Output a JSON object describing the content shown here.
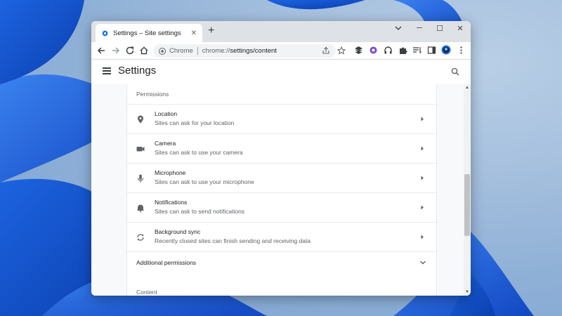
{
  "browser": {
    "tab_title": "Settings – Site settings",
    "tab_close": "✕",
    "new_tab": "+",
    "omnibox_label": "Chrome",
    "url_host": "chrome://",
    "url_path": "settings/content"
  },
  "window_controls": {
    "minimize": "─",
    "maximize": "☐",
    "close": "✕"
  },
  "settings": {
    "title": "Settings"
  },
  "permissions": {
    "section_label": "Permissions",
    "items": [
      {
        "title": "Location",
        "subtitle": "Sites can ask for your location",
        "icon": "location-pin-icon"
      },
      {
        "title": "Camera",
        "subtitle": "Sites can ask to use your camera",
        "icon": "camera-icon"
      },
      {
        "title": "Microphone",
        "subtitle": "Sites can ask to use your microphone",
        "icon": "microphone-icon"
      },
      {
        "title": "Notifications",
        "subtitle": "Sites can ask to send notifications",
        "icon": "bell-icon"
      },
      {
        "title": "Background sync",
        "subtitle": "Recently closed sites can finish sending and receiving data",
        "icon": "sync-icon"
      }
    ],
    "additional_label": "Additional permissions"
  },
  "content": {
    "section_label": "Content"
  },
  "colors": {
    "accent": "#1a73e8",
    "wallpaper": "#0b5bd3"
  }
}
